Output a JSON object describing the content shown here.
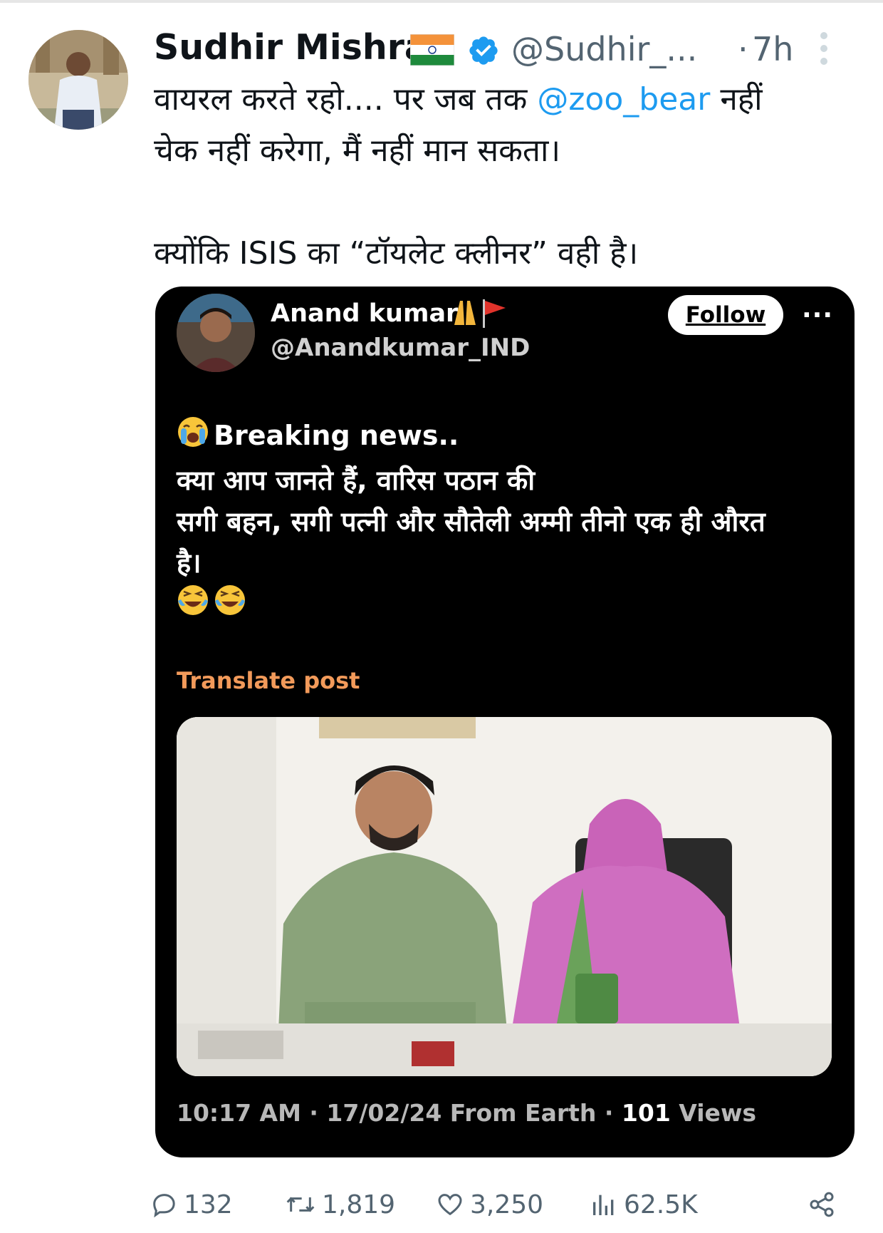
{
  "author": {
    "name": "Sudhir Mishra",
    "handle": "@Sudhir_...",
    "separator": "·",
    "time": "7h",
    "flag_icon": "india-flag-icon",
    "verified_icon": "verified-badge-icon"
  },
  "tweet": {
    "line1_before": "वायरल करते रहो.... पर जब तक ",
    "mention": "@zoo_bear",
    "line1_after": " नहीं",
    "line2": "चेक नहीं करेगा, मैं नहीं मान सकता।",
    "line3": "क्योंकि ISIS का “टॉयलेट क्लीनर” वही है।"
  },
  "quoted": {
    "name": "Anand kumar",
    "handle": "@Anandkumar_IND",
    "follow_label": "Follow",
    "more_label": "···",
    "text_line1": "Breaking news..",
    "text_line2": "क्या आप जानते हैं, वारिस पठान की",
    "text_line3": "सगी बहन, सगी पत्नी और सौतेली अम्मी तीनो एक ही औरत",
    "text_line4": "है।",
    "translate_label": "Translate post",
    "meta_time": "10:17 AM · 17/02/24 From Earth · ",
    "meta_views_count": "101",
    "meta_views_label": " Views"
  },
  "actions": {
    "replies": "132",
    "reposts": "1,819",
    "likes": "3,250",
    "views": "62.5K"
  },
  "colors": {
    "accent": "#1d9bf0",
    "secondary_text": "#536471",
    "translate": "#f29a5a",
    "card_bg": "#000000"
  }
}
